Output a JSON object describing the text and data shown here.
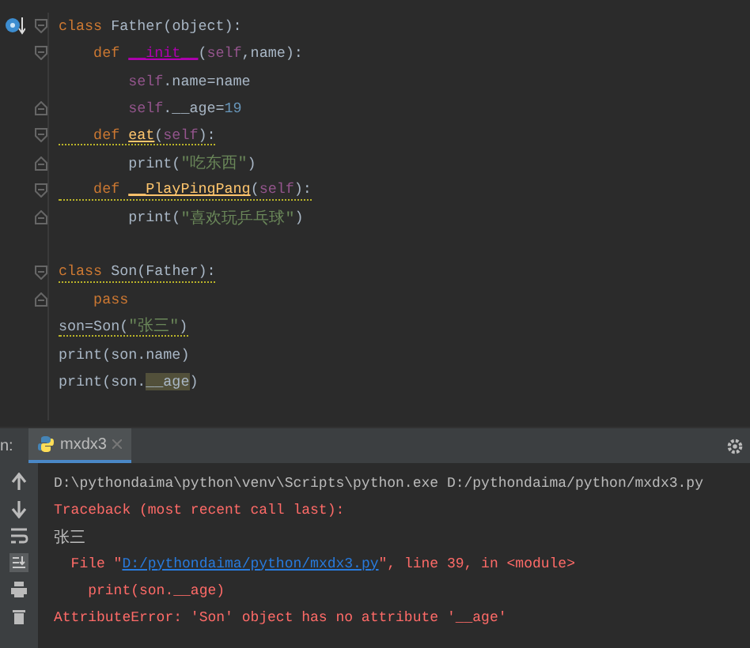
{
  "editor": {
    "lines": [
      {
        "fold_start": true,
        "fold_end": false,
        "marker": true,
        "warning": false,
        "tokens": [
          {
            "kind": "keyword",
            "text": "class "
          },
          {
            "kind": "text",
            "text": "Father(object):"
          }
        ]
      },
      {
        "fold_start": true,
        "fold_end": false,
        "marker": false,
        "warning": false,
        "tokens": [
          {
            "kind": "keyword",
            "text": "    def "
          },
          {
            "kind": "dunder",
            "text": "__init__"
          },
          {
            "kind": "text",
            "text": "("
          },
          {
            "kind": "self",
            "text": "self"
          },
          {
            "kind": "text",
            "text": ",name):"
          }
        ]
      },
      {
        "fold_start": false,
        "fold_end": false,
        "marker": false,
        "warning": false,
        "tokens": [
          {
            "kind": "self",
            "text": "        self"
          },
          {
            "kind": "text",
            "text": ".name=name"
          }
        ]
      },
      {
        "fold_start": false,
        "fold_end": true,
        "marker": false,
        "warning": false,
        "tokens": [
          {
            "kind": "self",
            "text": "        self"
          },
          {
            "kind": "text",
            "text": ".__age="
          },
          {
            "kind": "number",
            "text": "19"
          }
        ]
      },
      {
        "fold_start": true,
        "fold_end": false,
        "marker": false,
        "warning": true,
        "tokens": [
          {
            "kind": "keyword",
            "text": "    def "
          },
          {
            "kind": "func",
            "text": "eat"
          },
          {
            "kind": "text",
            "text": "("
          },
          {
            "kind": "self",
            "text": "self"
          },
          {
            "kind": "text",
            "text": "):"
          }
        ]
      },
      {
        "fold_start": false,
        "fold_end": true,
        "marker": false,
        "warning": false,
        "tokens": [
          {
            "kind": "text",
            "text": "        print("
          },
          {
            "kind": "string",
            "text": "\"吃东西\""
          },
          {
            "kind": "text",
            "text": ")"
          }
        ]
      },
      {
        "fold_start": true,
        "fold_end": false,
        "marker": false,
        "warning": true,
        "tokens": [
          {
            "kind": "keyword",
            "text": "    def "
          },
          {
            "kind": "func",
            "text": "__PlayPingPang"
          },
          {
            "kind": "text",
            "text": "("
          },
          {
            "kind": "self",
            "text": "self"
          },
          {
            "kind": "text",
            "text": "):"
          }
        ]
      },
      {
        "fold_start": false,
        "fold_end": true,
        "marker": false,
        "warning": false,
        "tokens": [
          {
            "kind": "text",
            "text": "        print("
          },
          {
            "kind": "string",
            "text": "\"喜欢玩乒乓球\""
          },
          {
            "kind": "text",
            "text": ")"
          }
        ]
      },
      {
        "fold_start": false,
        "fold_end": false,
        "marker": false
      },
      {
        "fold_start": true,
        "fold_end": false,
        "marker": false,
        "warning": true,
        "tokens": [
          {
            "kind": "keyword",
            "text": "class "
          },
          {
            "kind": "text",
            "text": "Son(Father):"
          }
        ]
      },
      {
        "fold_start": false,
        "fold_end": true,
        "marker": false,
        "warning": false,
        "tokens": [
          {
            "kind": "keyword",
            "text": "    pass"
          }
        ]
      },
      {
        "fold_start": false,
        "fold_end": false,
        "marker": false,
        "warning": true,
        "tokens": [
          {
            "kind": "text",
            "text": "son=Son("
          },
          {
            "kind": "string",
            "text": "\"张三\""
          },
          {
            "kind": "text",
            "text": ")"
          }
        ]
      },
      {
        "fold_start": false,
        "fold_end": false,
        "marker": false,
        "warning": false,
        "tokens": [
          {
            "kind": "text",
            "text": "print(son.name)"
          }
        ]
      },
      {
        "fold_start": false,
        "fold_end": false,
        "marker": false,
        "warning": false,
        "tokens": [
          {
            "kind": "text",
            "text": "print(son."
          },
          {
            "kind": "highlight",
            "text": "__age"
          },
          {
            "kind": "text",
            "text": ")"
          }
        ]
      }
    ]
  },
  "run_panel": {
    "label": "n:",
    "tab": {
      "title": "mxdx3",
      "selected": true
    },
    "lines": [
      [
        {
          "kind": "plain",
          "text": "D:\\pythondaima\\python\\venv\\Scripts\\python.exe D:/pythondaima/python/mxdx3.py"
        }
      ],
      [
        {
          "kind": "error",
          "text": "Traceback (most recent call last):"
        }
      ],
      [
        {
          "kind": "output",
          "text": "张三"
        }
      ],
      [
        {
          "kind": "error",
          "text": "  File \""
        },
        {
          "kind": "link",
          "text": "D:/pythondaima/python/mxdx3.py"
        },
        {
          "kind": "error",
          "text": "\", line 39, in <module>"
        }
      ],
      [
        {
          "kind": "error",
          "text": "    print(son.__age)"
        }
      ],
      [
        {
          "kind": "error",
          "text": "AttributeError: 'Son' object has no attribute '__age'"
        }
      ]
    ]
  }
}
